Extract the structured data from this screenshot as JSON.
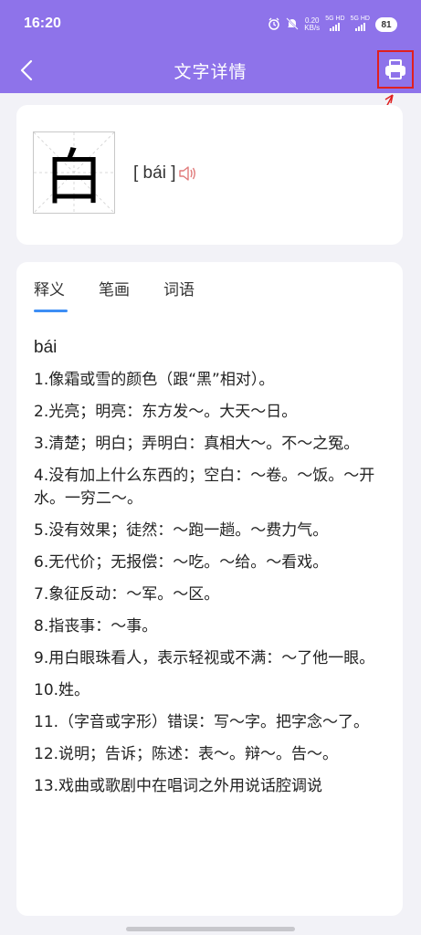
{
  "status_bar": {
    "time": "16:20",
    "speed_value": "0.20",
    "speed_unit": "KB/s",
    "network_1": "5G HD",
    "network_2": "5G HD",
    "battery": "81"
  },
  "nav": {
    "title": "文字详情"
  },
  "character": {
    "glyph": "白",
    "pinyin": "[ bái ]"
  },
  "tabs": [
    {
      "label": "释义",
      "active": true
    },
    {
      "label": "笔画",
      "active": false
    },
    {
      "label": "词语",
      "active": false
    }
  ],
  "definitions": {
    "pinyin": "bái",
    "items": [
      "1.像霜或雪的颜色（跟“黑”相对）。",
      "2.光亮；明亮：东方发～。大天～日。",
      "3.清楚；明白；弄明白：真相大～。不～之冤。",
      "4.没有加上什么东西的；空白：～卷。～饭。～开水。一穷二～。",
      "5.没有效果；徒然：～跑一趟。～费力气。",
      "6.无代价；无报偿：～吃。～给。～看戏。",
      "7.象征反动：～军。～区。",
      "8.指丧事：～事。",
      "9.用白眼珠看人，表示轻视或不满：～了他一眼。",
      "10.姓。",
      "11.（字音或字形）错误：写～字。把字念～了。",
      "12.说明；告诉；陈述：表～。辩～。告～。",
      "13.戏曲或歌剧中在唱词之外用说话腔调说"
    ]
  },
  "colors": {
    "header": "#8e73ea",
    "tab_indicator": "#3d8ef5",
    "highlight": "#e02020",
    "speaker": "#e07a7a"
  }
}
